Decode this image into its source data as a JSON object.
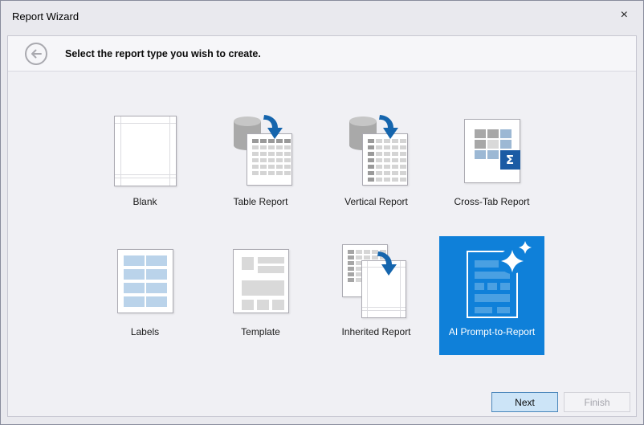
{
  "window": {
    "title": "Report Wizard"
  },
  "icons": {
    "close": "×",
    "back": "←",
    "sigma": "Σ",
    "sparkle": "✦",
    "database": "db-cylinder",
    "data_flow_arrow": "curved-down-arrow"
  },
  "header": {
    "instruction": "Select the report type you wish to create."
  },
  "tiles": [
    {
      "label": "Blank",
      "selected": false
    },
    {
      "label": "Table Report",
      "selected": false
    },
    {
      "label": "Vertical Report",
      "selected": false
    },
    {
      "label": "Cross-Tab Report",
      "selected": false
    },
    {
      "label": "Labels",
      "selected": false
    },
    {
      "label": "Template",
      "selected": false
    },
    {
      "label": "Inherited Report",
      "selected": false
    },
    {
      "label": "AI Prompt-to-Report",
      "selected": true
    }
  ],
  "footer": {
    "next": "Next",
    "finish": "Finish",
    "finish_enabled": false
  },
  "colors": {
    "selection_blue": "#0f80d9",
    "selection_bar_blue": "#4aa0e2",
    "arrow_blue": "#1565ad",
    "sigma_box_blue": "#1b5ba4",
    "labels_cell_blue": "#bad3ea",
    "crosstab_cell_blue": "#9cb8d4",
    "next_button_bg": "#cce4f7",
    "next_button_border": "#4a86ba",
    "dialog_bg": "#e9e9ee",
    "panel_bg": "#f0f0f4"
  }
}
